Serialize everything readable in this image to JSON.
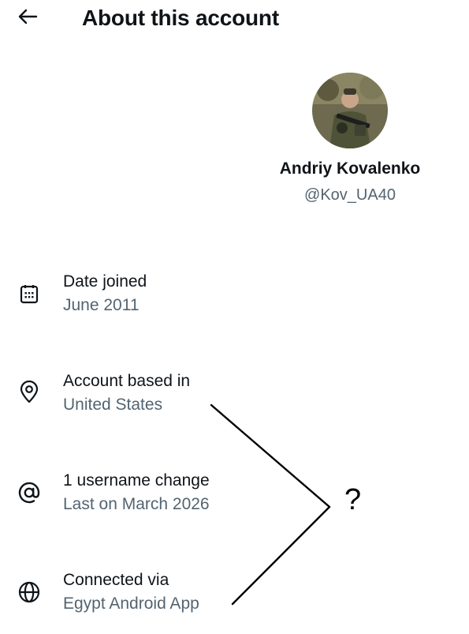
{
  "header": {
    "title": "About this account",
    "back_icon": "arrow-left-icon"
  },
  "profile": {
    "display_name": "Andriy Kovalenko",
    "handle": "@Kov_UA40"
  },
  "details": [
    {
      "icon": "calendar-icon",
      "label": "Date joined",
      "value": "June 2011"
    },
    {
      "icon": "location-pin-icon",
      "label": "Account based in",
      "value": "United States"
    },
    {
      "icon": "at-sign-icon",
      "label": "1 username change",
      "value": "Last on March 2026"
    },
    {
      "icon": "globe-icon",
      "label": "Connected via",
      "value": "Egypt Android App"
    }
  ],
  "annotation": {
    "mark": "?"
  },
  "colors": {
    "text_primary": "#0f1419",
    "text_secondary": "#536471",
    "background": "#ffffff"
  }
}
